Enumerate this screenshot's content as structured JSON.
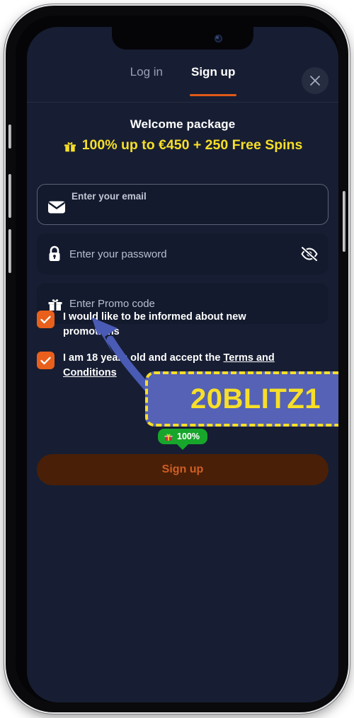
{
  "phone": {
    "frame_color": "#0a0a0c",
    "screen_bg": "#171e33",
    "side_buttons": [
      "silent-switch",
      "volume-up",
      "volume-down",
      "power"
    ]
  },
  "header": {
    "tabs": [
      {
        "label": "Log in",
        "active": false
      },
      {
        "label": "Sign up",
        "active": true
      }
    ],
    "active_underline_color": "#e15a18",
    "close_icon": "close-icon"
  },
  "promo_header": {
    "title": "Welcome package",
    "gift_icon": "gift-icon",
    "offer": "100% up to €450 + 250 Free Spins",
    "offer_color": "#f7df28"
  },
  "form": {
    "email": {
      "icon": "envelope-icon",
      "label": "Enter your email",
      "value": ""
    },
    "password": {
      "icon": "lock-icon",
      "placeholder": "Enter your password",
      "value": "",
      "toggle_icon": "eye-off-icon"
    },
    "promo": {
      "icon": "gift-icon",
      "placeholder": "Enter Promo code",
      "value": ""
    }
  },
  "consents": [
    {
      "checked": true,
      "checkbox_color": "#e8601c",
      "text": "I would like to be informed about new promotions"
    },
    {
      "checked": true,
      "checkbox_color": "#e8601c",
      "text_before": "I am 18 years old and accept the ",
      "text_link": "Terms and Conditions"
    }
  ],
  "bonus_badge": {
    "icon": "gift-icon",
    "label": "100%",
    "bg_color": "#17a62b"
  },
  "submit": {
    "label": "Sign up",
    "bg_color": "#4a1f07",
    "text_color": "#cf5f23",
    "disabled": true
  },
  "annotation": {
    "promo_code": "20BLITZ1",
    "box_bg": "#5562b5",
    "box_border": "#f7df28",
    "text_color": "#f7df28",
    "arrow_color": "#4a5bb5",
    "arrow_icon": "curved-arrow-icon",
    "arrow_points_to": "promo-code-field"
  }
}
